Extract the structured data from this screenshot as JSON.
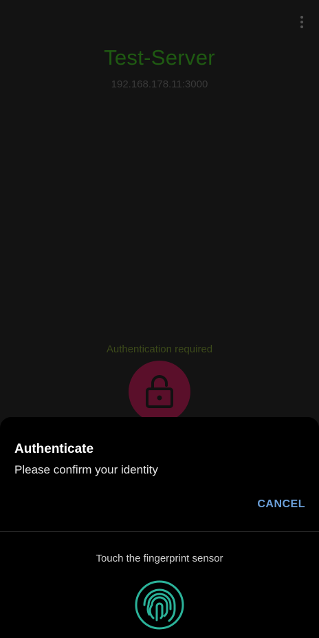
{
  "app": {
    "server_name": "Test-Server",
    "server_address": "192.168.178.11:3000",
    "auth_status": "Authentication required",
    "menu_icon": "more-vert-icon",
    "lock_icon": "lock-icon",
    "colors": {
      "server_name": "#1f5a12",
      "lock_button": "#5a0f2a",
      "background": "#131313"
    }
  },
  "dialog": {
    "title": "Authenticate",
    "subtitle": "Please confirm your identity",
    "cancel_label": "CANCEL",
    "fingerprint_hint": "Touch the fingerprint sensor",
    "fingerprint_icon": "fingerprint-icon",
    "colors": {
      "accent": "#6b9fd8",
      "fingerprint": "#2bb39a"
    }
  }
}
